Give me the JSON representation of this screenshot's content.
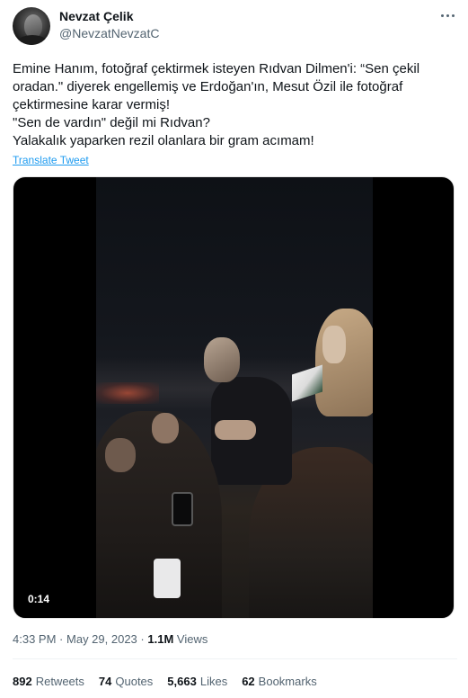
{
  "author": {
    "name": "Nevzat Çelik",
    "handle": "@NevzatNevzatC",
    "avatar_icon": "user-avatar-photo"
  },
  "tweet": {
    "lines": [
      "Emine Hanım, fotoğraf çektirmek isteyen Rıdvan Dilmen'i: “Sen çekil oradan.\" diyerek engellemiş ve  Erdoğan'ın, Mesut Özil ile fotoğraf çektirmesine karar vermiş!",
      "\"Sen de vardın\" değil mi Rıdvan?",
      "Yalakalık yaparken rezil olanlara bir gram acımam!"
    ],
    "translate_label": "Translate Tweet"
  },
  "video": {
    "duration": "0:14"
  },
  "meta": {
    "time": "4:33 PM",
    "separator": "·",
    "date": "May 29, 2023",
    "views_count": "1.1M",
    "views_label": "Views"
  },
  "stats": {
    "retweets": {
      "count": "892",
      "label": "Retweets"
    },
    "quotes": {
      "count": "74",
      "label": "Quotes"
    },
    "likes": {
      "count": "5,663",
      "label": "Likes"
    },
    "bookmarks": {
      "count": "62",
      "label": "Bookmarks"
    }
  },
  "colors": {
    "link": "#1d9bf0",
    "secondary_text": "#536471",
    "primary_text": "#0f1419"
  }
}
